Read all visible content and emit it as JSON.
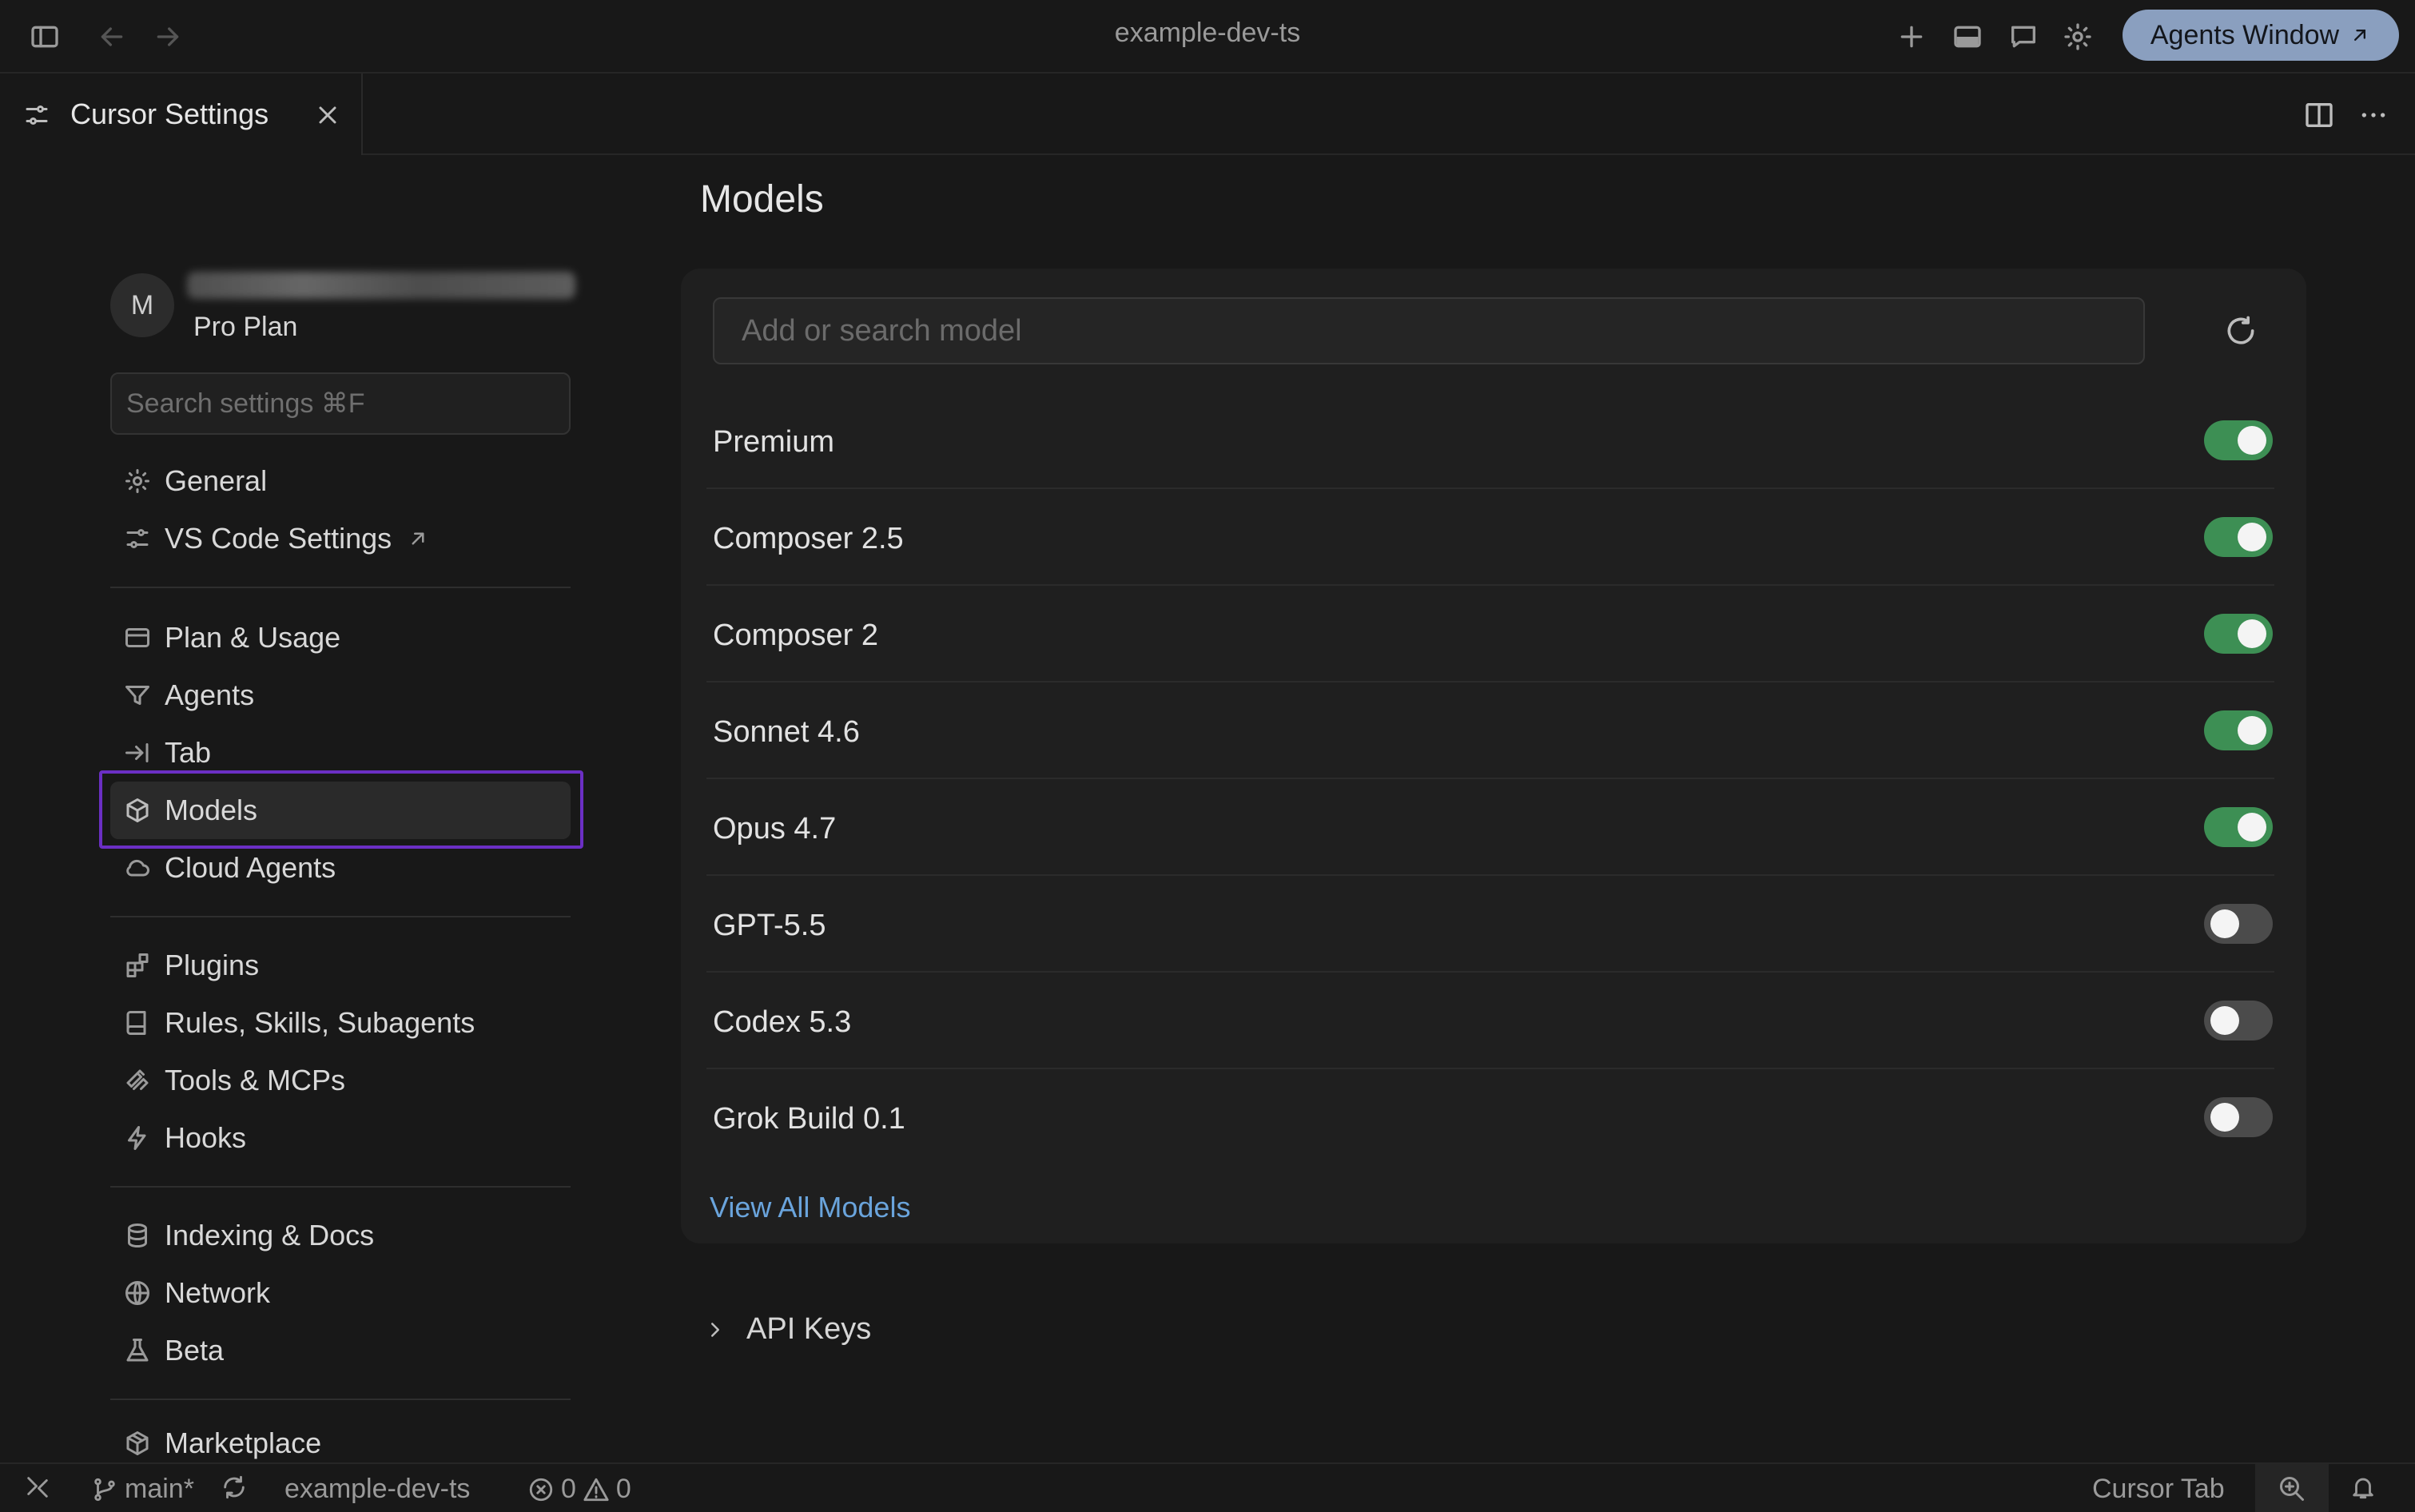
{
  "window": {
    "title": "example-dev-ts",
    "agents_button_label": "Agents Window"
  },
  "tab": {
    "label": "Cursor Settings"
  },
  "sidebar": {
    "account": {
      "avatar_initial": "M",
      "plan": "Pro Plan"
    },
    "search_placeholder": "Search settings ⌘F",
    "items": [
      {
        "label": "General",
        "icon": "gear-icon"
      },
      {
        "label": "VS Code Settings",
        "icon": "sliders-icon"
      },
      {
        "label": "Plan & Usage",
        "icon": "credit-card-icon"
      },
      {
        "label": "Agents",
        "icon": "filter-icon"
      },
      {
        "label": "Tab",
        "icon": "arrow-to-line-icon"
      },
      {
        "label": "Models",
        "icon": "cube-icon"
      },
      {
        "label": "Cloud Agents",
        "icon": "cloud-icon"
      },
      {
        "label": "Plugins",
        "icon": "puzzle-grid-icon"
      },
      {
        "label": "Rules, Skills, Subagents",
        "icon": "book-icon"
      },
      {
        "label": "Tools & MCPs",
        "icon": "tools-icon"
      },
      {
        "label": "Hooks",
        "icon": "lightning-icon"
      },
      {
        "label": "Indexing & Docs",
        "icon": "database-icon"
      },
      {
        "label": "Network",
        "icon": "globe-icon"
      },
      {
        "label": "Beta",
        "icon": "flask-icon"
      },
      {
        "label": "Marketplace",
        "icon": "package-icon"
      }
    ],
    "active_item": "Models"
  },
  "main": {
    "title": "Models",
    "search_placeholder": "Add or search model",
    "models": [
      {
        "name": "Premium",
        "enabled": true
      },
      {
        "name": "Composer 2.5",
        "enabled": true
      },
      {
        "name": "Composer 2",
        "enabled": true
      },
      {
        "name": "Sonnet 4.6",
        "enabled": true
      },
      {
        "name": "Opus 4.7",
        "enabled": true
      },
      {
        "name": "GPT-5.5",
        "enabled": false
      },
      {
        "name": "Codex 5.3",
        "enabled": false
      },
      {
        "name": "Grok Build 0.1",
        "enabled": false
      }
    ],
    "view_all_label": "View All Models",
    "api_keys_label": "API Keys"
  },
  "statusbar": {
    "branch": "main*",
    "project": "example-dev-ts",
    "errors": "0",
    "warnings": "0",
    "cursor_tab": "Cursor Tab"
  },
  "colors": {
    "toggle_on": "#3d8f54",
    "toggle_off": "#4b4b4b",
    "link": "#6aa4dc",
    "highlight": "#6b2fc4",
    "agents_button": "#8a9fbf"
  }
}
